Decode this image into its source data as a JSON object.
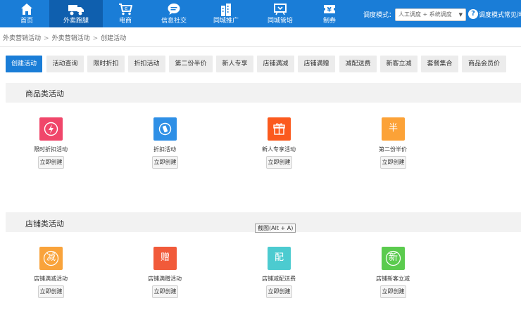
{
  "nav": {
    "items": [
      {
        "label": "首页",
        "icon": "home-icon"
      },
      {
        "label": "外卖跑腿",
        "icon": "delivery-truck-icon"
      },
      {
        "label": "电商",
        "icon": "shopping-cart-icon"
      },
      {
        "label": "信息社交",
        "icon": "chat-bubble-icon"
      },
      {
        "label": "同城推广",
        "icon": "city-building-icon"
      },
      {
        "label": "同城管培",
        "icon": "board-icon"
      },
      {
        "label": "制券",
        "icon": "coupon-yen-icon"
      }
    ],
    "active_index": 1,
    "mode_label": "调度模式：",
    "mode_value": "人工调度 + 系统调度",
    "help_text": "调度模式常见问"
  },
  "breadcrumb": [
    "外卖营销活动",
    "外卖营销活动",
    "创建活动"
  ],
  "tabs": [
    "创建活动",
    "活动查询",
    "限时折扣",
    "折扣活动",
    "第二份半价",
    "新人专享",
    "店铺满减",
    "店铺满赠",
    "减配送费",
    "新客立减",
    "套餐集合",
    "商品会员价"
  ],
  "active_tab": 0,
  "sections": [
    {
      "title": "商品类活动",
      "cards": [
        {
          "name": "限时折扣活动",
          "button": "立即创建",
          "glyph": "⚡",
          "color": "#f0466a",
          "icon": "lightning-icon"
        },
        {
          "name": "折扣活动",
          "button": "立即创建",
          "glyph": "◐",
          "color": "#2e8fe6",
          "icon": "discount-tag-icon"
        },
        {
          "name": "新人专享活动",
          "button": "立即创建",
          "glyph": "🎁",
          "color": "#fb5a1e",
          "icon": "gift-icon"
        },
        {
          "name": "第二份半价",
          "button": "立即创建",
          "glyph": "半",
          "color": "#fca237",
          "icon": "half-price-icon"
        }
      ]
    },
    {
      "title": "店铺类活动",
      "cards": [
        {
          "name": "店铺满减活动",
          "button": "立即创建",
          "glyph": "减",
          "color": "#f9a33b",
          "icon": "reduce-icon"
        },
        {
          "name": "店铺满赠活动",
          "button": "立即创建",
          "glyph": "赠",
          "color": "#f15a3a",
          "icon": "gift-bonus-icon"
        },
        {
          "name": "店铺减配送费",
          "button": "立即创建",
          "glyph": "配",
          "color": "#4ccbd0",
          "icon": "delivery-fee-icon"
        },
        {
          "name": "店铺新客立减",
          "button": "立即创建",
          "glyph": "新",
          "color": "#5bcb4e",
          "icon": "new-customer-icon"
        }
      ]
    }
  ],
  "tooltip": "截图(Alt + A)"
}
